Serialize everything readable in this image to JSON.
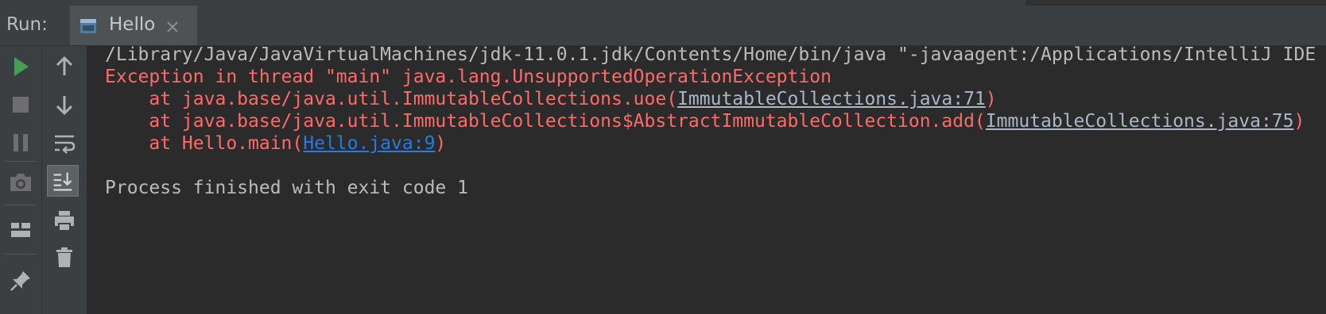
{
  "header": {
    "run_label": "Run:",
    "tab": {
      "label": "Hello",
      "icon": "application-config-icon"
    }
  },
  "toolbar": {
    "left": [
      "rerun-icon",
      "stop-icon",
      "pause-icon",
      "screenshot-icon",
      "layout-icon",
      "pin-icon"
    ],
    "right": [
      "up-arrow-icon",
      "down-arrow-icon",
      "soft-wrap-icon",
      "scroll-to-end-icon",
      "print-icon",
      "trash-icon"
    ]
  },
  "console": {
    "command": "/Library/Java/JavaVirtualMachines/jdk-11.0.1.jdk/Contents/Home/bin/java \"-javaagent:/Applications/IntelliJ IDE",
    "exception": "Exception in thread \"main\" java.lang.UnsupportedOperationException",
    "trace": [
      {
        "prefix": "    at java.base/java.util.ImmutableCollections.uoe(",
        "link": "ImmutableCollections.java:71",
        "suffix": ")"
      },
      {
        "prefix": "    at java.base/java.util.ImmutableCollections$AbstractImmutableCollection.add(",
        "link": "ImmutableCollections.java:75",
        "suffix": ")"
      },
      {
        "prefix": "    at Hello.main(",
        "link": "Hello.java:9",
        "suffix": ")"
      }
    ],
    "exit": "Process finished with exit code 1"
  },
  "colors": {
    "error": "#ff6b68",
    "stdout": "#bbbbbb",
    "link_blue": "#287bde",
    "run_green": "#499c54"
  }
}
